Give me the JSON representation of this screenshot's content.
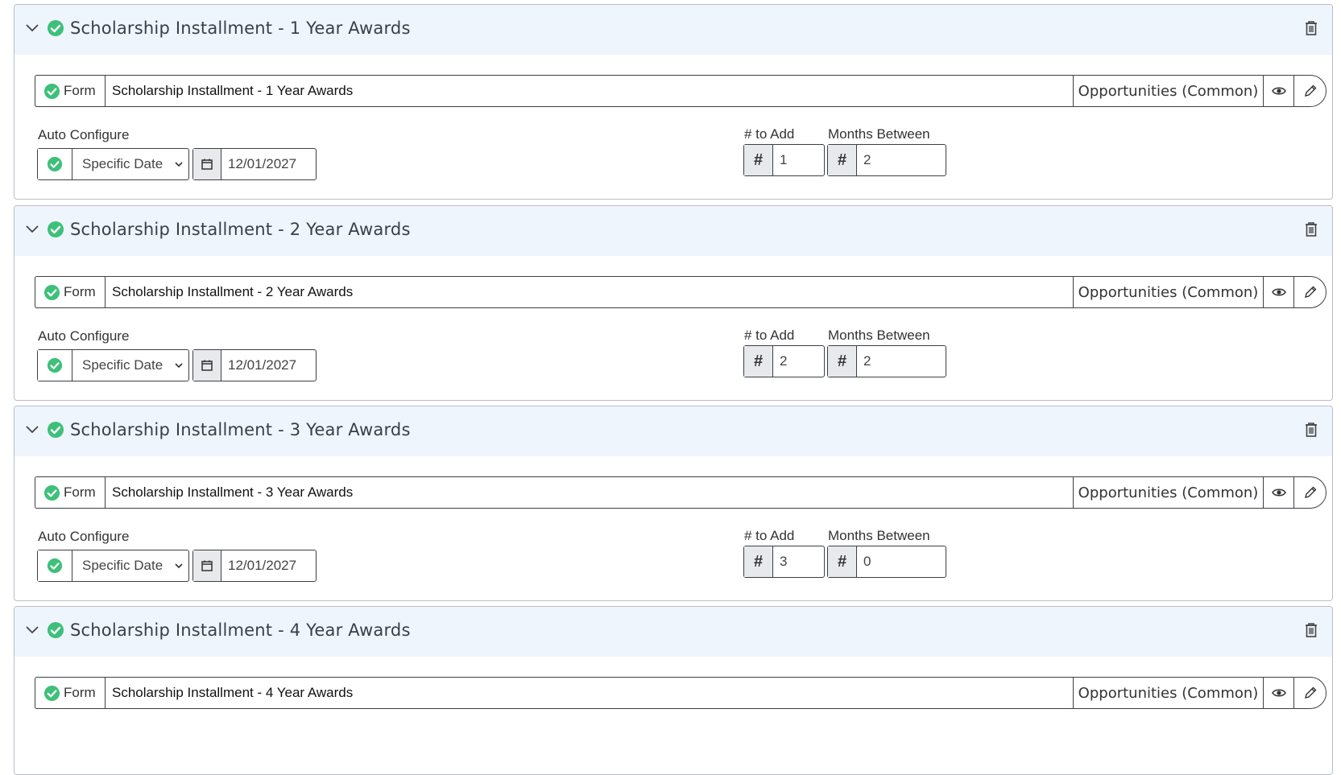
{
  "labels": {
    "form_tag": "Form",
    "auto_configure": "Auto Configure",
    "num_to_add": "# to Add",
    "months_between": "Months Between",
    "hash": "#"
  },
  "colors": {
    "success": "#3ec07a",
    "header_bg": "#eef5fd",
    "border": "#3c3f44"
  },
  "panels": [
    {
      "title": "Scholarship Installment - 1 Year Awards",
      "form_name": "Scholarship Installment - 1 Year Awards",
      "category": "Opportunities (Common)",
      "auto_mode": "Specific Date",
      "date": "12/01/2027",
      "num_to_add": "1",
      "months_between": "2"
    },
    {
      "title": "Scholarship Installment - 2 Year Awards",
      "form_name": "Scholarship Installment - 2 Year Awards",
      "category": "Opportunities (Common)",
      "auto_mode": "Specific Date",
      "date": "12/01/2027",
      "num_to_add": "2",
      "months_between": "2"
    },
    {
      "title": "Scholarship Installment - 3 Year Awards",
      "form_name": "Scholarship Installment - 3 Year Awards",
      "category": "Opportunities (Common)",
      "auto_mode": "Specific Date",
      "date": "12/01/2027",
      "num_to_add": "3",
      "months_between": "0"
    },
    {
      "title": "Scholarship Installment - 4 Year Awards",
      "form_name": "Scholarship Installment - 4 Year Awards",
      "category": "Opportunities (Common)"
    }
  ]
}
